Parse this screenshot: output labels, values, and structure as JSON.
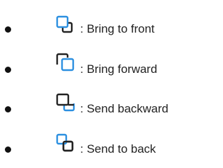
{
  "colors": {
    "accent": "#2b8fe0",
    "outline": "#222222",
    "text": "#222222"
  },
  "items": [
    {
      "icon": "bring-to-front-icon",
      "label": ": Bring to front"
    },
    {
      "icon": "bring-forward-icon",
      "label": ": Bring forward"
    },
    {
      "icon": "send-backward-icon",
      "label": ": Send backward"
    },
    {
      "icon": "send-to-back-icon",
      "label": ": Send to back"
    }
  ]
}
